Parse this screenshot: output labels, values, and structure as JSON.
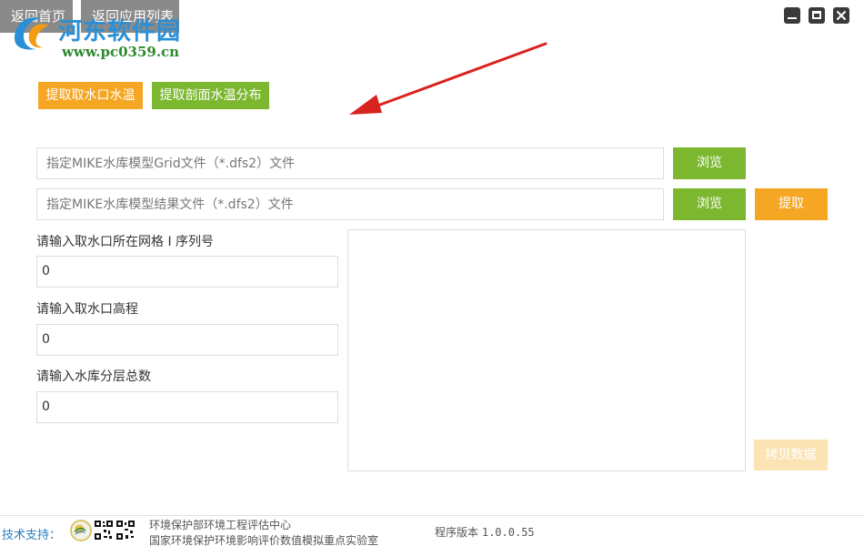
{
  "nav": {
    "home_label": "返回首页",
    "apps_label": "返回应用列表"
  },
  "watermark": {
    "title": "河东软件园",
    "url": "www.pc0359.cn"
  },
  "window_controls": [
    "minimize-icon",
    "maximize-icon",
    "close-icon"
  ],
  "modes": {
    "intake_label": "提取取水口水温",
    "section_label": "提取剖面水温分布"
  },
  "files": {
    "grid_placeholder": "指定MIKE水库模型Grid文件（*.dfs2）文件",
    "result_placeholder": "指定MIKE水库模型结果文件（*.dfs2）文件",
    "browse_label": "浏览",
    "extract_label": "提取"
  },
  "params": {
    "grid_index_label": "请输入取水口所在网格 I 序列号",
    "grid_index_value": "0",
    "intake_elev_label": "请输入取水口高程",
    "intake_elev_value": "0",
    "layer_count_label": "请输入水库分层总数",
    "layer_count_value": "0"
  },
  "output": {
    "content": "",
    "copy_label": "拷贝数据"
  },
  "footer": {
    "support_label": "技术支持：",
    "org_line1": "环境保护部环境工程评估中心",
    "org_line2": "国家环境保护环境影响评价数值模拟重点实验室",
    "version_label": "程序版本",
    "version_value": "1.0.0.55"
  },
  "colors": {
    "orange": "#f5a623",
    "green": "#7cb82f",
    "disabled_orange": "#fbe3b4",
    "arrow_red": "#d9231f",
    "nav_gray": "#8a8a8a"
  }
}
